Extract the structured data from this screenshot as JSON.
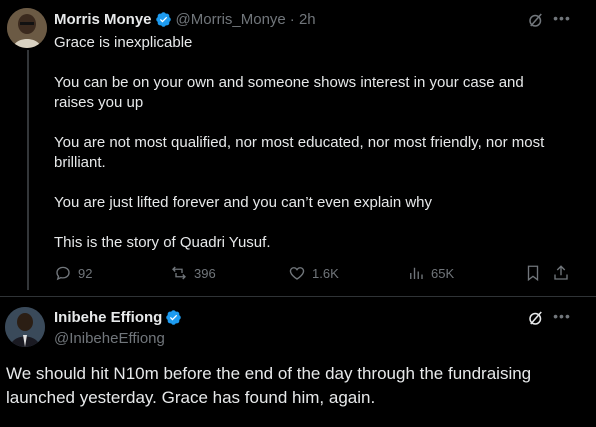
{
  "tweet1": {
    "name": "Morris Monye",
    "handle": "@Morris_Monye",
    "time": "· 2h",
    "lines": [
      "Grace is inexplicable",
      "You can be on your own and someone shows interest in your case and",
      "raises you up",
      "You are not most qualified, nor most educated, nor most friendly, nor most",
      "brilliant.",
      "You are just lifted forever and you can’t even explain why",
      "This is the story of Quadri Yusuf."
    ],
    "stats": {
      "replies": "92",
      "reposts": "396",
      "likes": "1.6K",
      "views": "65K"
    }
  },
  "tweet2": {
    "name": "Inibehe Effiong",
    "handle": "@InibeheEffiong",
    "lines": [
      "We should hit N10m before the end of the day through the fundraising",
      "launched yesterday. Grace has found him, again."
    ]
  },
  "colors": {
    "background": "#000000",
    "text": "#e7e9ea",
    "muted": "#71767b",
    "verified": "#1d9bf0",
    "divider": "#2f3336"
  }
}
